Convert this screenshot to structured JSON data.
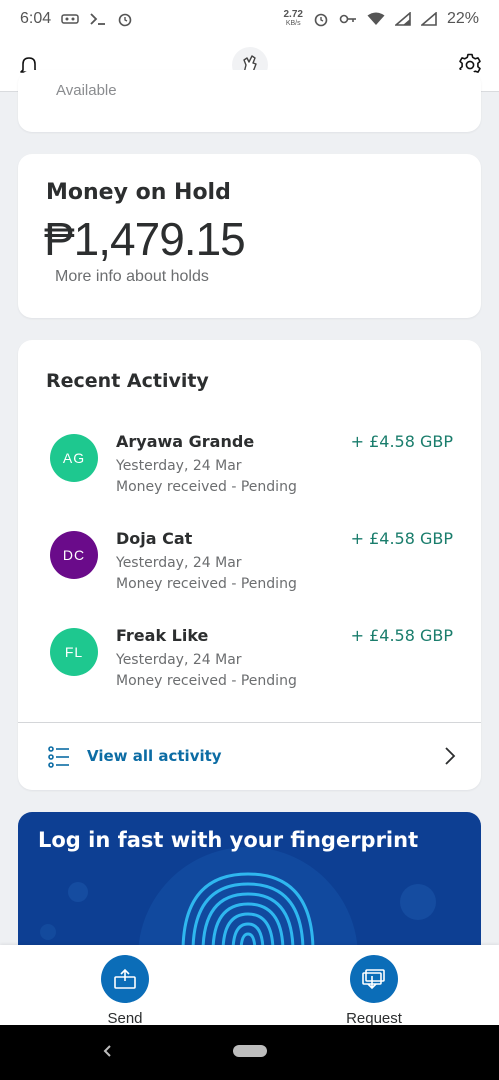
{
  "status_bar": {
    "time": "6:04",
    "net_speed": "2.72",
    "net_unit": "KB/s",
    "battery": "22%"
  },
  "top_card": {
    "faded_text": "Available"
  },
  "money_on_hold": {
    "title": "Money on Hold",
    "amount": "₱1,479.15",
    "link": "More info about holds"
  },
  "recent_activity": {
    "title": "Recent Activity",
    "items": [
      {
        "initials": "AG",
        "name": "Aryawa Grande",
        "date": "Yesterday, 24 Mar",
        "status": "Money received - Pending",
        "amount": "+ £4.58 GBP",
        "color": "#1ec88f"
      },
      {
        "initials": "DC",
        "name": "Doja Cat",
        "date": "Yesterday, 24 Mar",
        "status": "Money received - Pending",
        "amount": "+ £4.58 GBP",
        "color": "#6a0b8a"
      },
      {
        "initials": "FL",
        "name": "Freak Like",
        "date": "Yesterday, 24 Mar",
        "status": "Money received - Pending",
        "amount": "+ £4.58 GBP",
        "color": "#1ec88f"
      }
    ],
    "view_all": "View all activity"
  },
  "promo": {
    "title": "Log in fast with your fingerprint"
  },
  "bottom_nav": {
    "send": "Send",
    "request": "Request"
  },
  "colors": {
    "brand_blue": "#0b6db8",
    "promo_blue": "#0d3f93",
    "positive_green": "#1a7d6c",
    "link_blue": "#0c6ca4"
  }
}
